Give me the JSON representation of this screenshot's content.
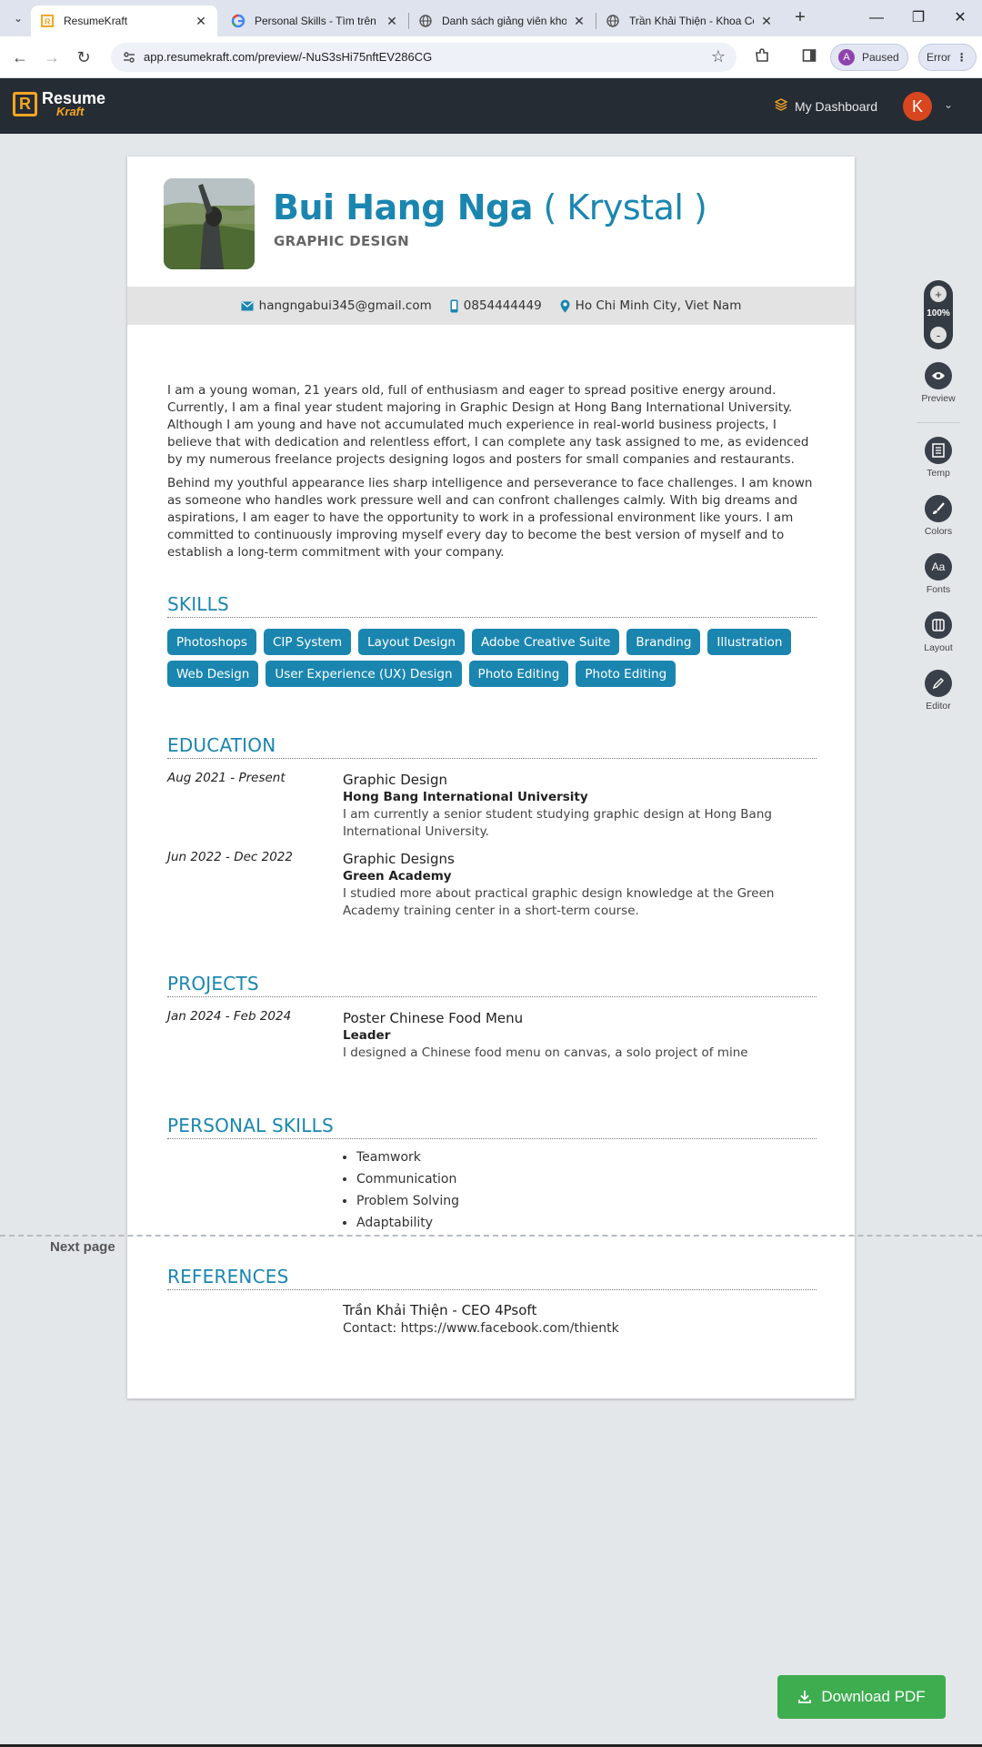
{
  "browser": {
    "tabs": [
      {
        "title": "ResumeKraft",
        "icon": "resumekraft-favicon",
        "active": true
      },
      {
        "title": "Personal Skills - Tìm trên Google",
        "icon": "google-icon"
      },
      {
        "title": "Danh sách giảng viên khoa",
        "icon": "globe-icon"
      },
      {
        "title": "Trần Khải Thiện - Khoa Công",
        "icon": "globe-icon"
      }
    ],
    "url": "app.resumekraft.com/preview/-NuS3sHi75nftEV286CG",
    "profile_initial": "A",
    "profile_label": "Paused",
    "error_label": "Error"
  },
  "app": {
    "logo_line1": "Resume",
    "logo_line2": "Kraft",
    "dashboard_label": "My Dashboard",
    "user_initial": "K"
  },
  "resume": {
    "first_name": "Bui Hang Nga",
    "nickname": " ( Krystal )",
    "role": "GRAPHIC DESIGN",
    "email": "hangngabui345@gmail.com",
    "phone": "0854444449",
    "location": "Ho Chi Minh City, Viet Nam",
    "summary": [
      "I am a young woman, 21 years old, full of enthusiasm and eager to spread positive energy around. Currently, I am a final year student majoring in Graphic Design at Hong Bang International University. Although I am young and have not accumulated much experience in real-world business projects, I believe that with dedication and relentless effort, I can complete any task assigned to me, as evidenced by my numerous freelance projects designing logos and posters for small companies and restaurants.",
      "Behind my youthful appearance lies sharp intelligence and perseverance to face challenges. I am known as someone who handles work pressure well and can confront challenges calmly. With big dreams and aspirations, I am eager to have the opportunity to work in a professional environment like yours. I am committed to continuously improving myself every day to become the best version of myself and to establish a long-term commitment with your company."
    ],
    "sections": {
      "skills": "SKILLS",
      "education": "EDUCATION",
      "projects": "PROJECTS",
      "personal_skills": "PERSONAL SKILLS",
      "references": "REFERENCES"
    },
    "skills": [
      "Photoshops",
      "CIP System",
      "Layout Design",
      "Adobe Creative Suite",
      "Branding",
      "Illustration",
      "Web Design",
      "User Experience (UX) Design",
      "Photo Editing",
      "Photo Editing"
    ],
    "education": [
      {
        "date": "Aug 2021 - Present",
        "degree": "Graphic Design",
        "school": "Hong Bang International University",
        "desc": "I am currently a senior student studying graphic design at Hong Bang International University."
      },
      {
        "date": "Jun 2022 - Dec 2022",
        "degree": "Graphic Designs",
        "school": "Green Academy",
        "desc": "I studied more about practical graphic design knowledge at the Green Academy training center in a short-term course."
      }
    ],
    "projects": [
      {
        "date": "Jan 2024 - Feb 2024",
        "title": "Poster Chinese Food Menu",
        "role": "Leader",
        "desc": "I designed a Chinese food menu on canvas, a solo project of mine"
      }
    ],
    "personal_skills": [
      "Teamwork",
      "Communication",
      "Problem Solving",
      "Adaptability"
    ],
    "references": [
      {
        "name": "Trần Khải Thiện - CEO 4Psoft",
        "contact": "Contact: https://www.facebook.com/thientk"
      }
    ]
  },
  "page": {
    "next_page_label": "Next page"
  },
  "tools": {
    "zoom_value": "100%",
    "zoom_in": "+",
    "zoom_out": "-",
    "items": [
      {
        "label": "Preview",
        "icon": "eye-icon"
      },
      {
        "label": "Temp",
        "icon": "template-icon"
      },
      {
        "label": "Colors",
        "icon": "brush-icon"
      },
      {
        "label": "Fonts",
        "icon": "fonts-icon"
      },
      {
        "label": "Layout",
        "icon": "layout-icon"
      },
      {
        "label": "Editor",
        "icon": "pencil-icon"
      }
    ]
  },
  "download_label": "Download PDF",
  "colors": {
    "accent": "#1a86b0",
    "header_bg": "#262c34",
    "brand_orange": "#f5a623",
    "download_green": "#3dad4f"
  }
}
